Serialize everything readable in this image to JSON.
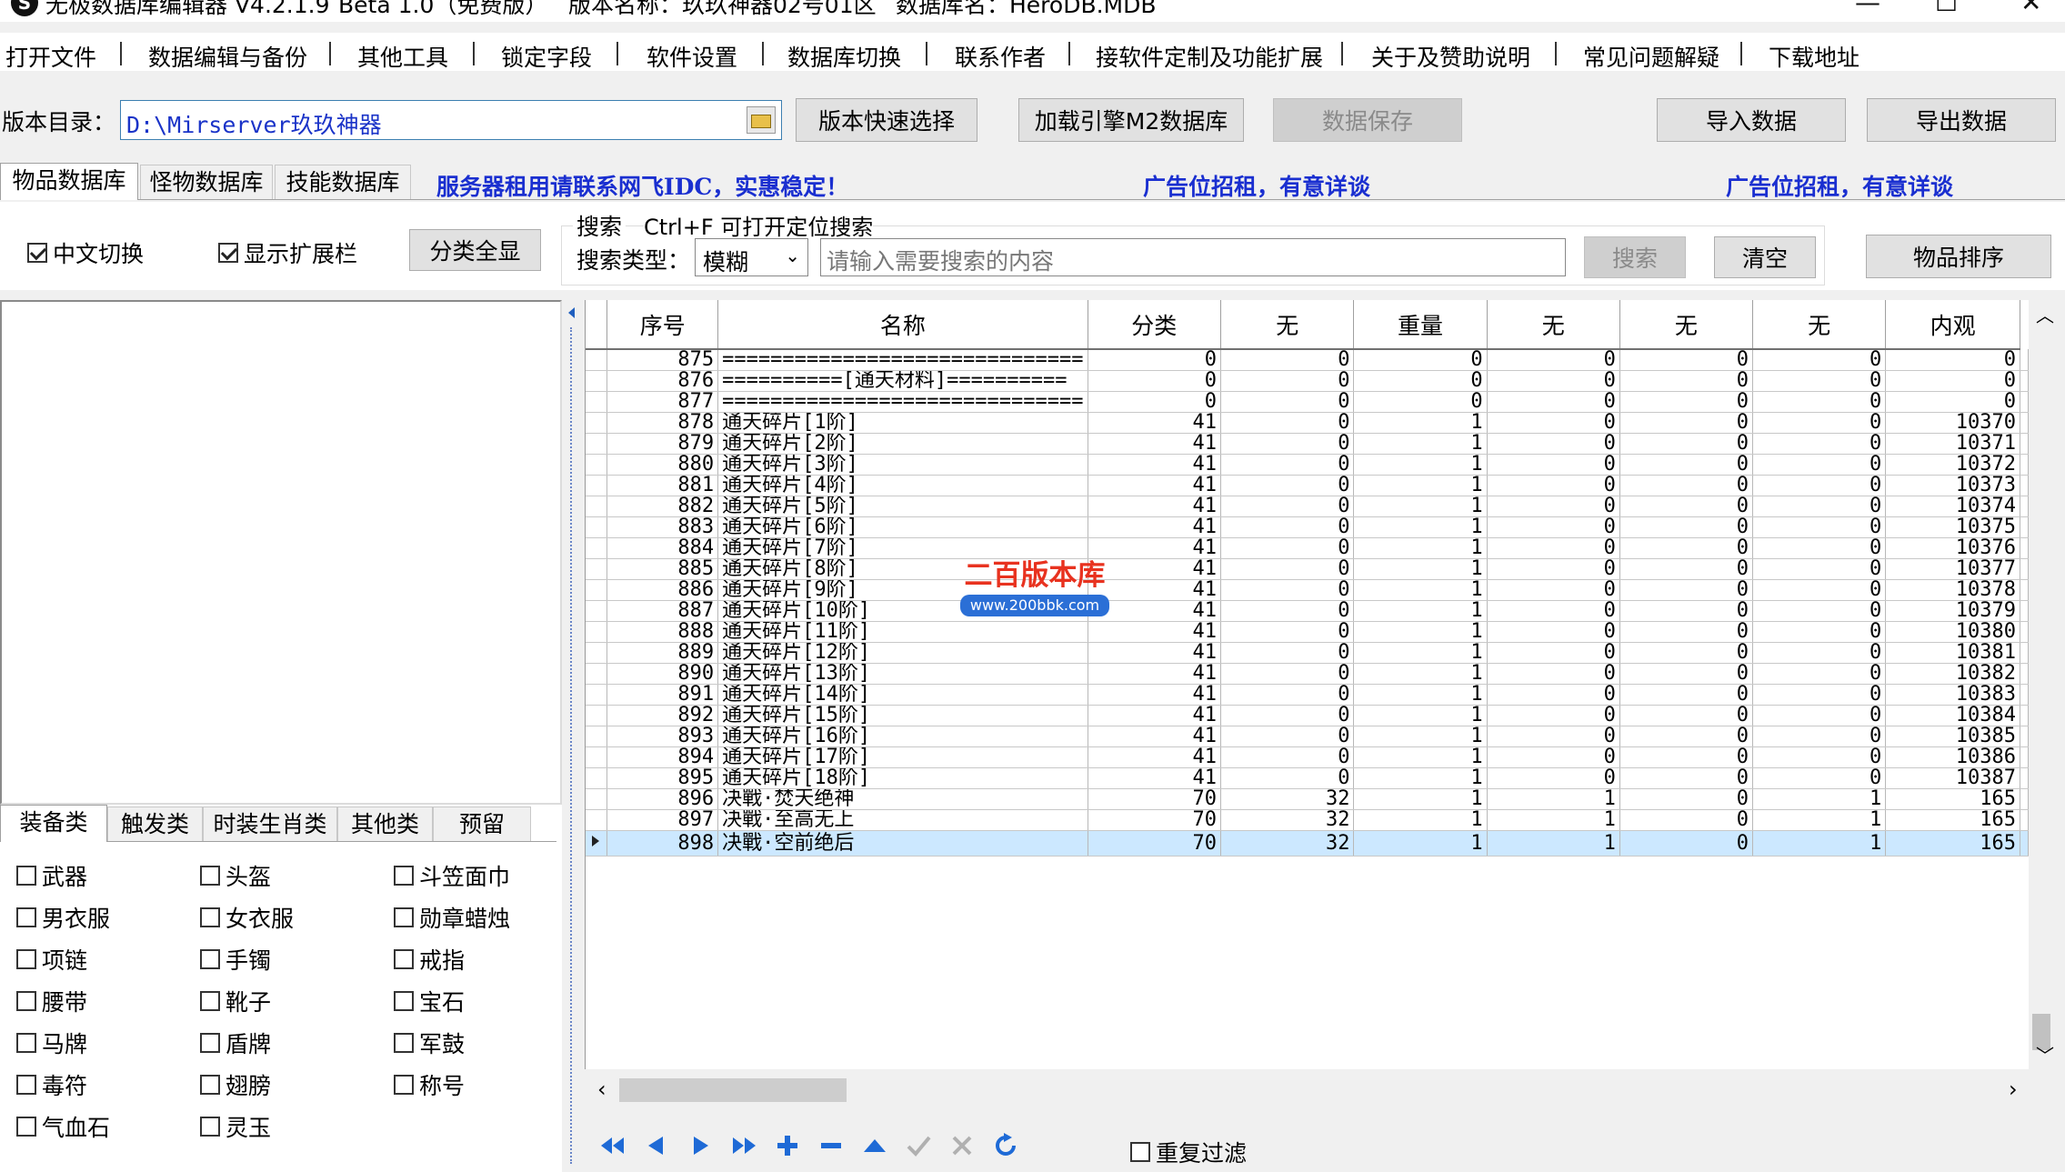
{
  "window": {
    "app_title": "无极数据库编辑器 V4.2.1.9",
    "beta": "Beta 1.0（免费版）",
    "version_name": "版本名称：玖玖神器02号01区",
    "db_name": "数据库名：HeroDB.MDB",
    "app_icon": "S",
    "minimize": "—",
    "maximize": "☐",
    "close": "✕"
  },
  "menu": [
    "打开文件",
    "数据编辑与备份",
    "其他工具",
    "锁定字段",
    "软件设置",
    "数据库切换",
    "联系作者",
    "接软件定制及功能扩展",
    "关于及赞助说明",
    "常见问题解疑",
    "下载地址"
  ],
  "toolbar": {
    "dir_label": "版本目录：",
    "dir_value": "D:\\Mirserver玖玖神器",
    "quick_select": "版本快速选择",
    "load_engine": "加载引擎M2数据库",
    "save": "数据保存",
    "import": "导入数据",
    "export": "导出数据"
  },
  "tabs": [
    "物品数据库",
    "怪物数据库",
    "技能数据库"
  ],
  "promo": {
    "server": "服务器租用请联系网飞IDC，实惠稳定！",
    "ad1": "广告位招租，有意详谈",
    "ad2": "广告位招租，有意详谈"
  },
  "options": {
    "cn_switch": "中文切换",
    "show_ext": "显示扩展栏",
    "show_all": "分类全显"
  },
  "search": {
    "title": "搜索",
    "hint": "Ctrl+F 可打开定位搜索",
    "type_label": "搜索类型：",
    "type_value": "模糊",
    "placeholder": "请输入需要搜索的内容",
    "search_btn": "搜索",
    "clear_btn": "清空",
    "sort_btn": "物品排序"
  },
  "category_tabs": [
    "装备类",
    "触发类",
    "时装生肖类",
    "其他类",
    "预留"
  ],
  "categories": [
    [
      "武器",
      "头盔",
      "斗笠面巾"
    ],
    [
      "男衣服",
      "女衣服",
      "勋章蜡烛"
    ],
    [
      "项链",
      "手镯",
      "戒指"
    ],
    [
      "腰带",
      "靴子",
      "宝石"
    ],
    [
      "马牌",
      "盾牌",
      "军鼓"
    ],
    [
      "毒符",
      "翅膀",
      "称号"
    ],
    [
      "气血石",
      "灵玉"
    ]
  ],
  "grid": {
    "columns": [
      "序号",
      "名称",
      "分类",
      "无",
      "重量",
      "无",
      "无",
      "无",
      "内观"
    ],
    "rows": [
      [
        "875",
        "==============================",
        "0",
        "0",
        "0",
        "0",
        "0",
        "0",
        "0"
      ],
      [
        "876",
        "==========[通天材料]==========",
        "0",
        "0",
        "0",
        "0",
        "0",
        "0",
        "0"
      ],
      [
        "877",
        "==============================",
        "0",
        "0",
        "0",
        "0",
        "0",
        "0",
        "0"
      ],
      [
        "878",
        "通天碎片[1阶]",
        "41",
        "0",
        "1",
        "0",
        "0",
        "0",
        "10370"
      ],
      [
        "879",
        "通天碎片[2阶]",
        "41",
        "0",
        "1",
        "0",
        "0",
        "0",
        "10371"
      ],
      [
        "880",
        "通天碎片[3阶]",
        "41",
        "0",
        "1",
        "0",
        "0",
        "0",
        "10372"
      ],
      [
        "881",
        "通天碎片[4阶]",
        "41",
        "0",
        "1",
        "0",
        "0",
        "0",
        "10373"
      ],
      [
        "882",
        "通天碎片[5阶]",
        "41",
        "0",
        "1",
        "0",
        "0",
        "0",
        "10374"
      ],
      [
        "883",
        "通天碎片[6阶]",
        "41",
        "0",
        "1",
        "0",
        "0",
        "0",
        "10375"
      ],
      [
        "884",
        "通天碎片[7阶]",
        "41",
        "0",
        "1",
        "0",
        "0",
        "0",
        "10376"
      ],
      [
        "885",
        "通天碎片[8阶]",
        "41",
        "0",
        "1",
        "0",
        "0",
        "0",
        "10377"
      ],
      [
        "886",
        "通天碎片[9阶]",
        "41",
        "0",
        "1",
        "0",
        "0",
        "0",
        "10378"
      ],
      [
        "887",
        "通天碎片[10阶]",
        "41",
        "0",
        "1",
        "0",
        "0",
        "0",
        "10379"
      ],
      [
        "888",
        "通天碎片[11阶]",
        "41",
        "0",
        "1",
        "0",
        "0",
        "0",
        "10380"
      ],
      [
        "889",
        "通天碎片[12阶]",
        "41",
        "0",
        "1",
        "0",
        "0",
        "0",
        "10381"
      ],
      [
        "890",
        "通天碎片[13阶]",
        "41",
        "0",
        "1",
        "0",
        "0",
        "0",
        "10382"
      ],
      [
        "891",
        "通天碎片[14阶]",
        "41",
        "0",
        "1",
        "0",
        "0",
        "0",
        "10383"
      ],
      [
        "892",
        "通天碎片[15阶]",
        "41",
        "0",
        "1",
        "0",
        "0",
        "0",
        "10384"
      ],
      [
        "893",
        "通天碎片[16阶]",
        "41",
        "0",
        "1",
        "0",
        "0",
        "0",
        "10385"
      ],
      [
        "894",
        "通天碎片[17阶]",
        "41",
        "0",
        "1",
        "0",
        "0",
        "0",
        "10386"
      ],
      [
        "895",
        "通天碎片[18阶]",
        "41",
        "0",
        "1",
        "0",
        "0",
        "0",
        "10387"
      ],
      [
        "896",
        "决戰·焚天绝神",
        "70",
        "32",
        "1",
        "1",
        "0",
        "1",
        "165"
      ],
      [
        "897",
        "决戰·至高无上",
        "70",
        "32",
        "1",
        "1",
        "0",
        "1",
        "165"
      ],
      [
        "898",
        "决戰·空前绝后",
        "70",
        "32",
        "1",
        "1",
        "0",
        "1",
        "165"
      ]
    ],
    "selected_row": "898"
  },
  "watermark": {
    "title": "二百版本库",
    "url": "www.200bbk.com"
  },
  "nav": [
    "first-icon",
    "prev-icon",
    "next-icon",
    "last-icon",
    "add-icon",
    "delete-icon",
    "up-icon",
    "confirm-icon",
    "cancel-icon",
    "refresh-icon"
  ],
  "filter": {
    "dup_filter": "重复过滤"
  }
}
